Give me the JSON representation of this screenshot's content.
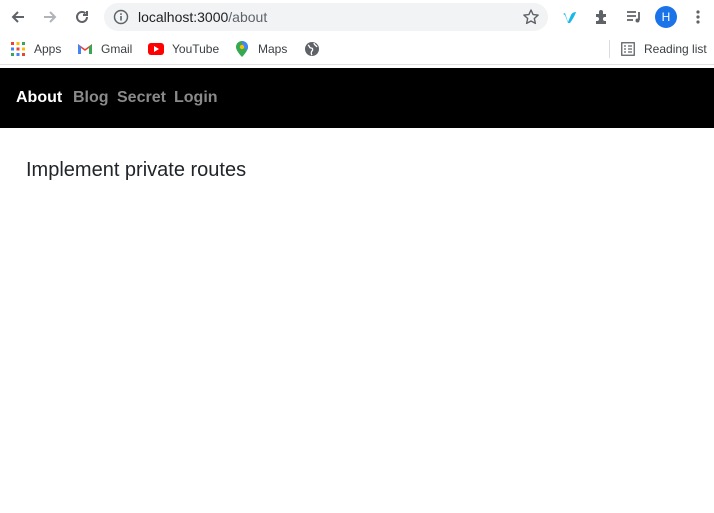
{
  "browser": {
    "address_host": "localhost:3000",
    "address_path": "/about",
    "profile_initial": "H",
    "bookmarks": [
      "Apps",
      "Gmail",
      "YouTube",
      "Maps"
    ],
    "reading_list": "Reading list"
  },
  "nav": {
    "links": [
      "About",
      "Blog",
      "Secret",
      "Login"
    ],
    "active": "About"
  },
  "main": {
    "heading": "Implement private routes"
  },
  "colors": {
    "navbar_bg": "#000000",
    "nav_active": "#ffffff",
    "nav_inactive": "#8a8a8a",
    "vimeo": "#1ab7ea",
    "profile": "#1a73e8"
  }
}
